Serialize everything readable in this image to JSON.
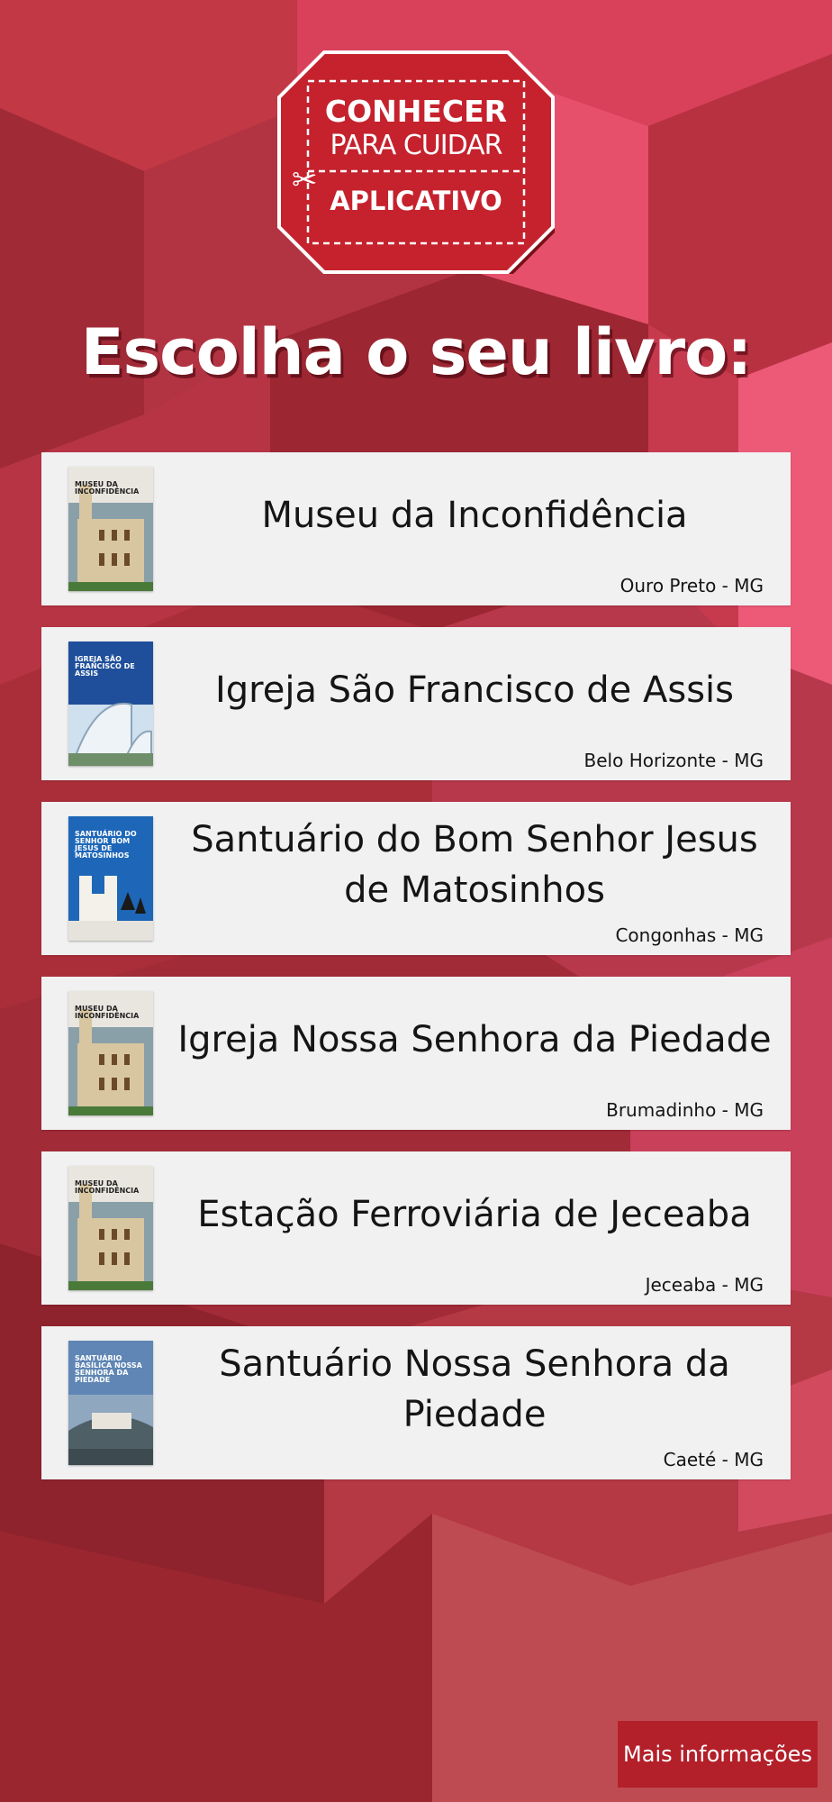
{
  "logo": {
    "line1": "CONHECER",
    "line2": "PARA CUIDAR",
    "line3": "APLICATIVO",
    "scissors_icon": "scissors-icon"
  },
  "heading": "Escolha o seu livro:",
  "books": [
    {
      "title": "Museu da Inconfidência",
      "place": "Ouro Preto - MG",
      "cover_text": "MUSEU DA INCONFIDÊNCIA",
      "cover_style": "building"
    },
    {
      "title": "Igreja São Francisco de Assis",
      "place": "Belo Horizonte - MG",
      "cover_text": "IGREJA SÃO FRANCISCO DE ASSIS",
      "cover_style": "blue-arch"
    },
    {
      "title": "Santuário do Bom Senhor Jesus de Matosinhos",
      "place": "Congonhas - MG",
      "cover_text": "SANTUÁRIO DO SENHOR BOM JESUS DE MATOSINHOS",
      "cover_style": "blue-church"
    },
    {
      "title": "Igreja Nossa Senhora da Piedade",
      "place": "Brumadinho - MG",
      "cover_text": "MUSEU DA INCONFIDÊNCIA",
      "cover_style": "building"
    },
    {
      "title": "Estação Ferroviária de Jeceaba",
      "place": "Jeceaba - MG",
      "cover_text": "MUSEU DA INCONFIDÊNCIA",
      "cover_style": "building"
    },
    {
      "title": "Santuário Nossa Senhora da Piedade",
      "place": "Caeté - MG",
      "cover_text": "SANTUÁRIO BASÍLICA NOSSA SENHORA DA PIEDADE",
      "cover_style": "sky"
    }
  ],
  "more_button": "Mais informações",
  "colors": {
    "brand_red": "#b3202a",
    "card_bg": "#f1f1f2",
    "page_bg": "#a3313a"
  }
}
